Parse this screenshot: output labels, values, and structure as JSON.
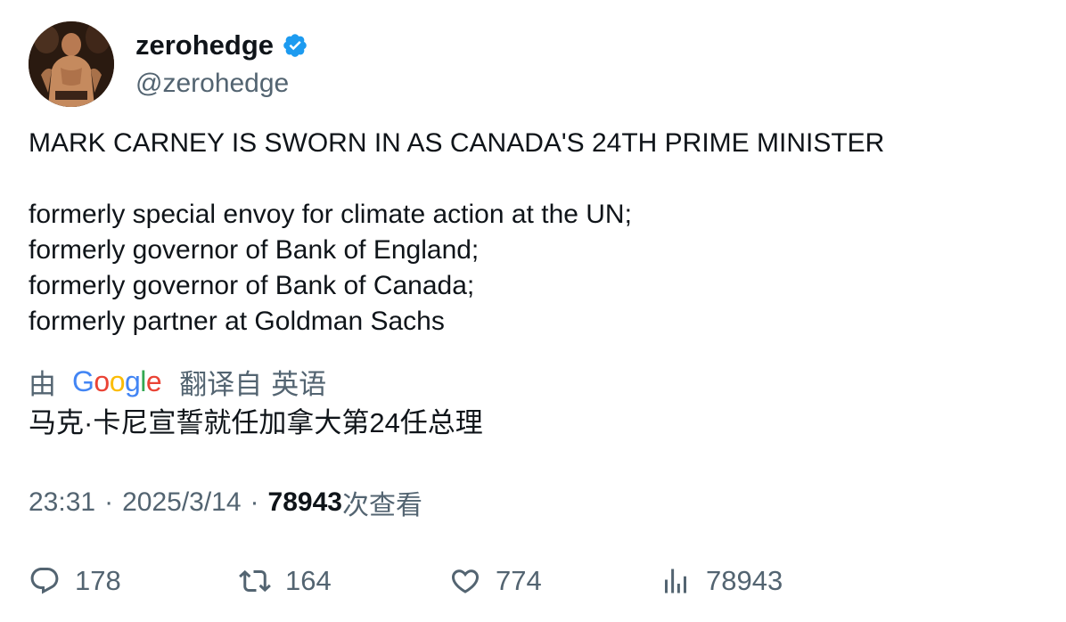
{
  "tweet": {
    "author": {
      "display_name": "zerohedge",
      "handle": "@zerohedge",
      "verified": true,
      "verified_icon": "verified-badge-icon",
      "accent_color": "#1d9bf0"
    },
    "text": "MARK CARNEY IS SWORN IN AS CANADA'S 24TH PRIME MINISTER\n\nformerly special envoy for climate action at the UN;\nformerly governor of Bank of England;\nformerly governor of Bank of Canada;\nformerly partner at Goldman Sachs",
    "translation": {
      "by_label": "由",
      "provider": "Google",
      "translated_from_label": "翻译自",
      "source_language": "英语",
      "translated_text": "马克·卡尼宣誓就任加拿大第24任总理"
    },
    "meta": {
      "time": "23:31",
      "separator": "·",
      "date": "2025/3/14",
      "views_count": "78943",
      "views_label": "次查看"
    },
    "actions": {
      "replies": "178",
      "retweets": "164",
      "likes": "774",
      "views": "78943"
    }
  }
}
